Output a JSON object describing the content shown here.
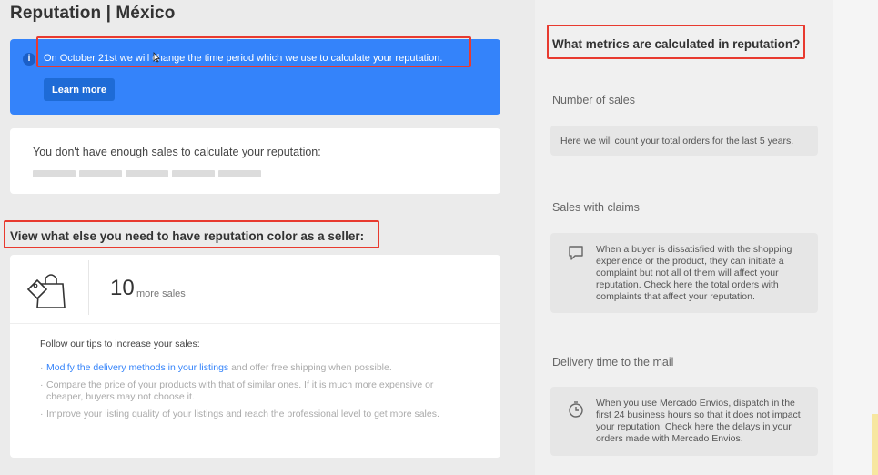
{
  "page": {
    "title": "Reputation | México"
  },
  "banner": {
    "message": "On October 21st we will change the time period which we use to calculate your reputation.",
    "button_label": "Learn more"
  },
  "sales_card": {
    "text": "You don't have enough sales to calculate your reputation:"
  },
  "more_section": {
    "heading": "View what else you need to have reputation color as a seller:",
    "count": "10",
    "unit": "more sales",
    "tips_title": "Follow our tips to increase your sales:",
    "tips": [
      {
        "link": "Modify the delivery methods in your listings",
        "rest": " and offer free shipping when possible."
      },
      {
        "link": "",
        "rest": "Compare the price of your products with that of similar ones. If it is much more expensive or cheaper, buyers may not choose it."
      },
      {
        "link": "",
        "rest": "Improve your listing quality of your listings and reach the professional level to get more sales."
      }
    ]
  },
  "metrics_panel": {
    "heading": "What metrics are calculated in reputation?",
    "metrics": [
      {
        "title": "Number of sales",
        "text": "Here we will count your total orders for the last 5 years.",
        "icon": ""
      },
      {
        "title": "Sales with claims",
        "text": "When a buyer is dissatisfied with the shopping experience or the product, they can initiate a complaint but not all of them will affect your reputation. Check here the total orders with complaints that affect your reputation.",
        "icon": "chat-bubble-icon"
      },
      {
        "title": "Delivery time to the mail",
        "text": "When you use Mercado Envios, dispatch in the first 24 business hours so that it does not impact your reputation. Check here the delays in your orders made with Mercado Envios.",
        "icon": "clock-icon"
      }
    ]
  },
  "colors": {
    "accent": "#3483fa",
    "highlight": "#e83a2f",
    "background": "#ebebeb"
  }
}
